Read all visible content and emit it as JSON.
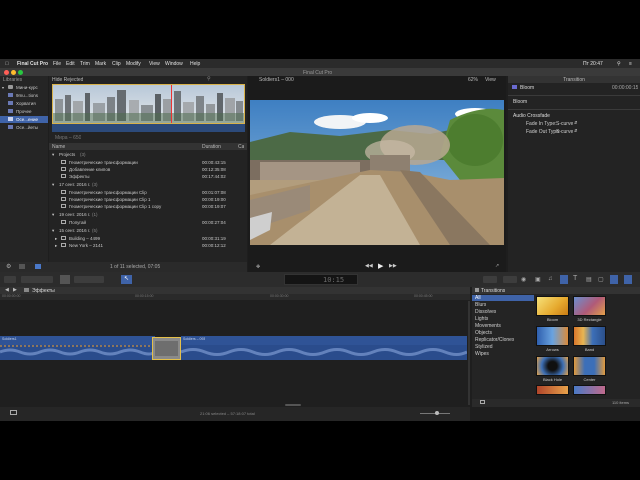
{
  "menubar": {
    "items": [
      "Final Cut Pro",
      "File",
      "Edit",
      "Trim",
      "Mark",
      "Clip",
      "Modify",
      "View",
      "Window",
      "Help"
    ],
    "clock": "Пт 20:47"
  },
  "window": {
    "title": "Final Cut Pro"
  },
  "libraries": {
    "header": "Libraries",
    "items": [
      "Мини-курс",
      "9mu...tions",
      "Хорватия",
      "Прочее",
      "Осе...ение",
      "Осе...йеты"
    ]
  },
  "browser": {
    "filter": "Hide Rejected",
    "thumb_caption": "Мира – 650",
    "col_name": "Name",
    "col_duration": "Duration",
    "col_extra": "Ca",
    "rows": [
      {
        "name": "Projects",
        "count": "(3)",
        "dur": ""
      },
      {
        "name": "Геометрические трансформации",
        "dur": "00:00:43:15"
      },
      {
        "name": "Добавление клипов",
        "dur": "00:12:35:08"
      },
      {
        "name": "Эффекты",
        "dur": "00:17:44:02"
      },
      {
        "name": "17 сент. 2016 г.",
        "count": "(3)",
        "dur": ""
      },
      {
        "name": "Геометрические трансформации Clip",
        "dur": "00:01:07:08"
      },
      {
        "name": "Геометрические трансформации Clip 1",
        "dur": "00:00:19:00"
      },
      {
        "name": "Геометрические трансформации Clip 1 copy",
        "dur": "00:00:19:07"
      },
      {
        "name": "19 сент. 2016 г.",
        "count": "(1)",
        "dur": ""
      },
      {
        "name": "Попугай",
        "dur": "00:00:27:04"
      },
      {
        "name": "15 сент. 2016 г.",
        "count": "(5)",
        "dur": ""
      },
      {
        "name": "Building – 4499",
        "dur": "00:00:31:19"
      },
      {
        "name": "New York – 2141",
        "dur": "00:00:12:12"
      }
    ],
    "status": "1 of 11 selected, 07:05"
  },
  "viewer": {
    "title": "Soldiers1 – 000",
    "zoom": "62%",
    "view_menu": "View"
  },
  "inspector": {
    "header": "Transition",
    "clip_name": "Bloom",
    "clip_time": "00:00:00:15",
    "section1": "Bloom",
    "section2": "Audio Crossfade",
    "fade_in_label": "Fade In Type:",
    "fade_in_value": "S-curve",
    "fade_out_label": "Fade Out Type:",
    "fade_out_value": "S-curve"
  },
  "toolbar": {
    "timecode": "10:15"
  },
  "timeline": {
    "project": "Эффекты",
    "clip1": "Soldiers1",
    "clip2": "Soldiers – 093",
    "status": "21:06 selected – 57:18:07 total",
    "ruler": [
      "00:00:00:00",
      "00:00:15:00",
      "00:00:30:00",
      "00:00:45:00"
    ]
  },
  "transitions": {
    "header": "Transitions",
    "categories": [
      "All",
      "Blurs",
      "Dissolves",
      "Lights",
      "Movements",
      "Objects",
      "Replicator/Clones",
      "Stylized",
      "Wipes"
    ],
    "items": [
      "Bloom",
      "3D Rectangle",
      "Arrows",
      "Band",
      "Black Hole",
      "Center",
      "",
      ""
    ],
    "count": "110 items"
  }
}
